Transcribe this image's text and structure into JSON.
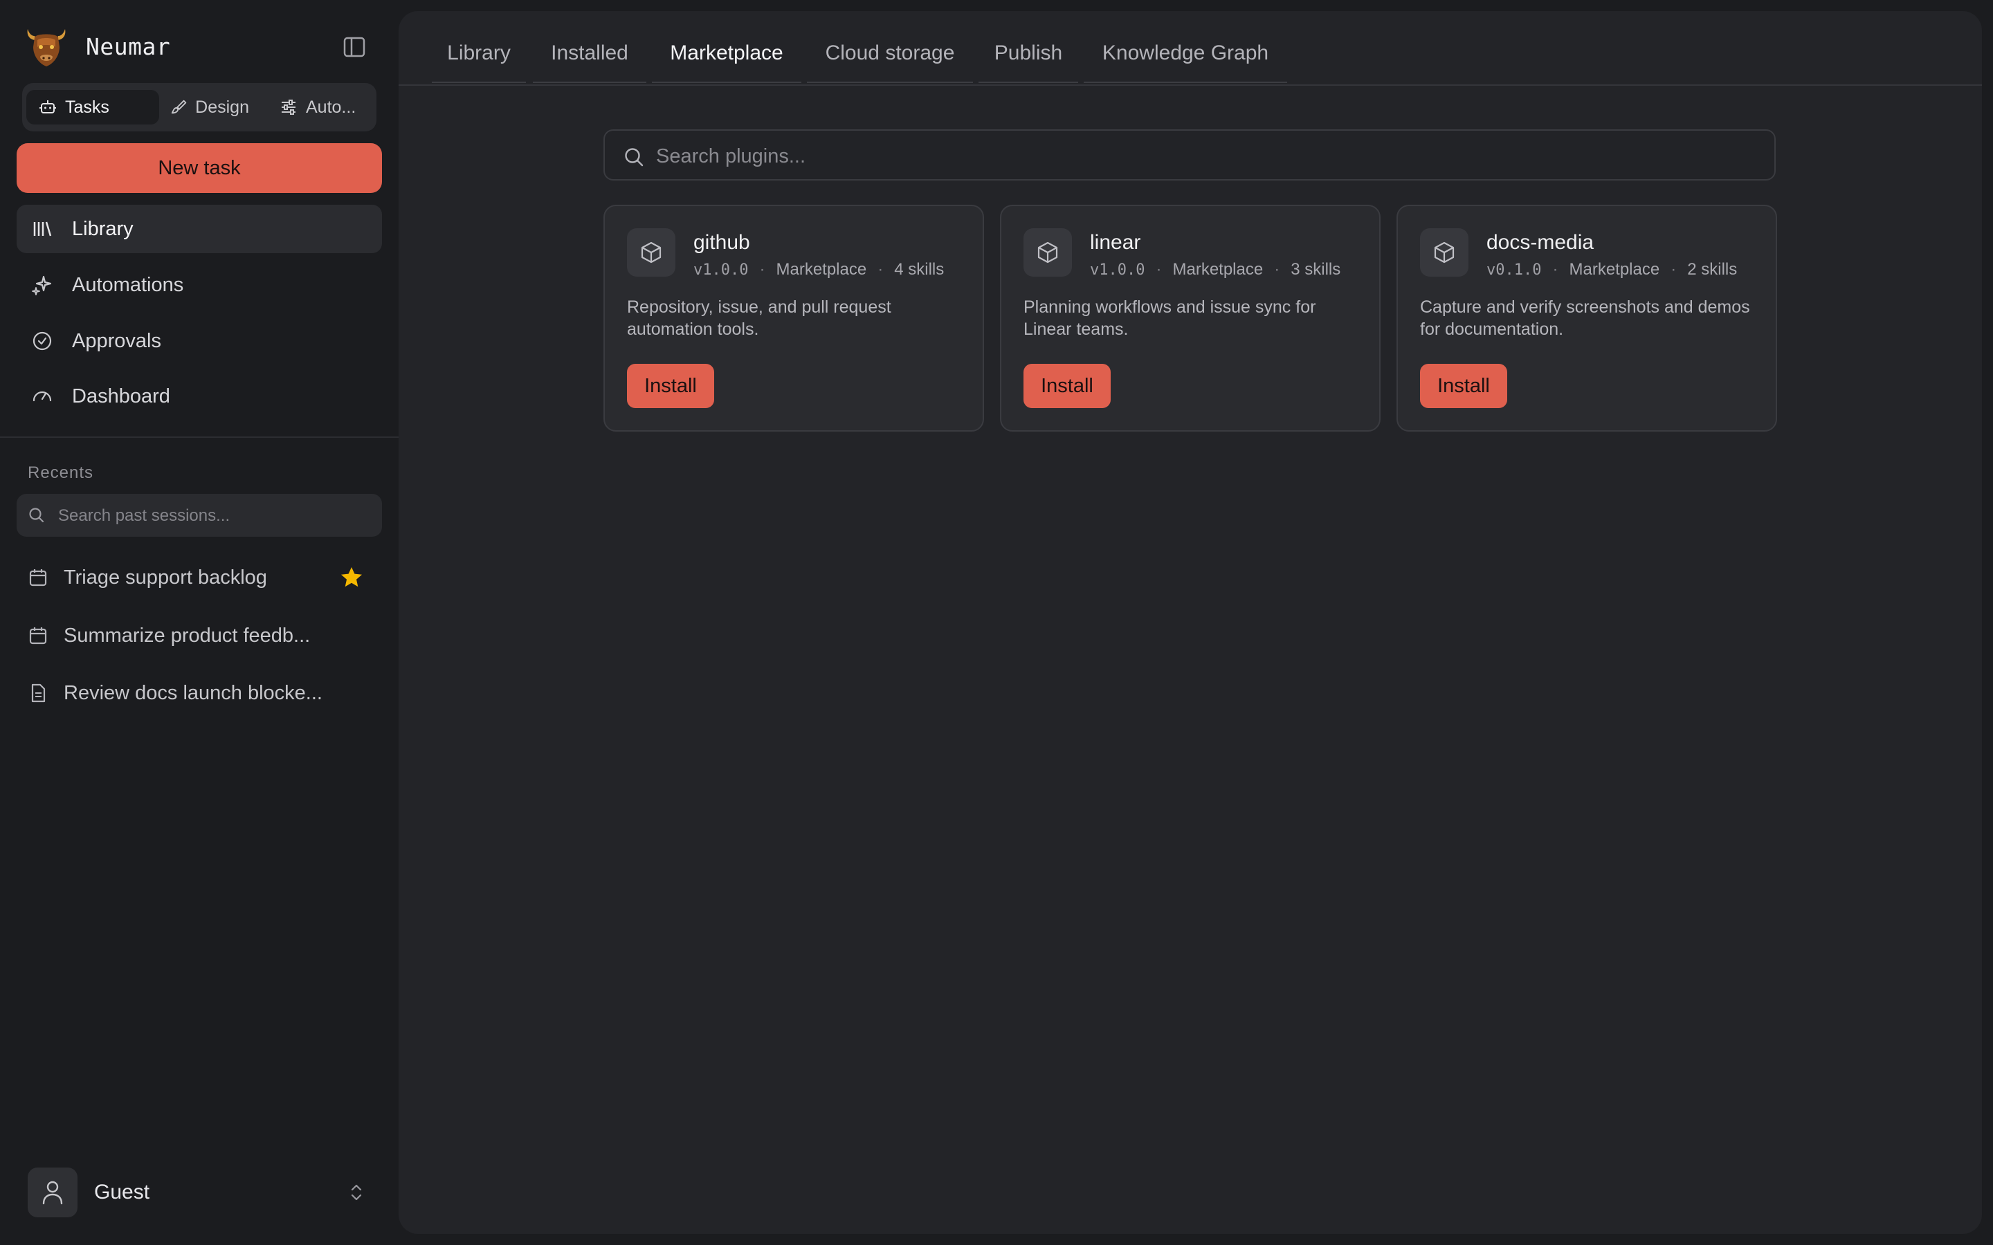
{
  "app": {
    "name": "Neumar"
  },
  "modes": [
    {
      "label": "Tasks",
      "icon": "robot-icon"
    },
    {
      "label": "Design",
      "icon": "brush-icon"
    },
    {
      "label": "Auto...",
      "icon": "sliders-icon"
    }
  ],
  "new_task_label": "New task",
  "nav": [
    {
      "label": "Library",
      "icon": "library-icon"
    },
    {
      "label": "Automations",
      "icon": "sparkles-icon"
    },
    {
      "label": "Approvals",
      "icon": "check-circle-icon"
    },
    {
      "label": "Dashboard",
      "icon": "gauge-icon"
    }
  ],
  "recents": {
    "title": "Recents",
    "search_placeholder": "Search past sessions...",
    "items": [
      {
        "label": "Triage support backlog",
        "icon": "calendar-icon",
        "starred": true
      },
      {
        "label": "Summarize product feedb...",
        "icon": "calendar-icon",
        "starred": false
      },
      {
        "label": "Review docs launch blocke...",
        "icon": "document-icon",
        "starred": false
      }
    ]
  },
  "user": {
    "name": "Guest"
  },
  "tabs": [
    "Library",
    "Installed",
    "Marketplace",
    "Cloud storage",
    "Publish",
    "Knowledge Graph"
  ],
  "active_tab": "Marketplace",
  "plugin_search": {
    "placeholder": "Search plugins..."
  },
  "plugins": [
    {
      "name": "github",
      "version": "v1.0.0",
      "source": "Marketplace",
      "skills": "4 skills",
      "description": "Repository, issue, and pull request automation tools.",
      "action": "Install"
    },
    {
      "name": "linear",
      "version": "v1.0.0",
      "source": "Marketplace",
      "skills": "3 skills",
      "description": "Planning workflows and issue sync for Linear teams.",
      "action": "Install"
    },
    {
      "name": "docs-media",
      "version": "v0.1.0",
      "source": "Marketplace",
      "skills": "2 skills",
      "description": "Capture and verify screenshots and demos for documentation.",
      "action": "Install"
    }
  ],
  "colors": {
    "accent": "#e0604e",
    "star": "#f5b800",
    "background": "#1b1c1f",
    "panel": "#232428"
  }
}
